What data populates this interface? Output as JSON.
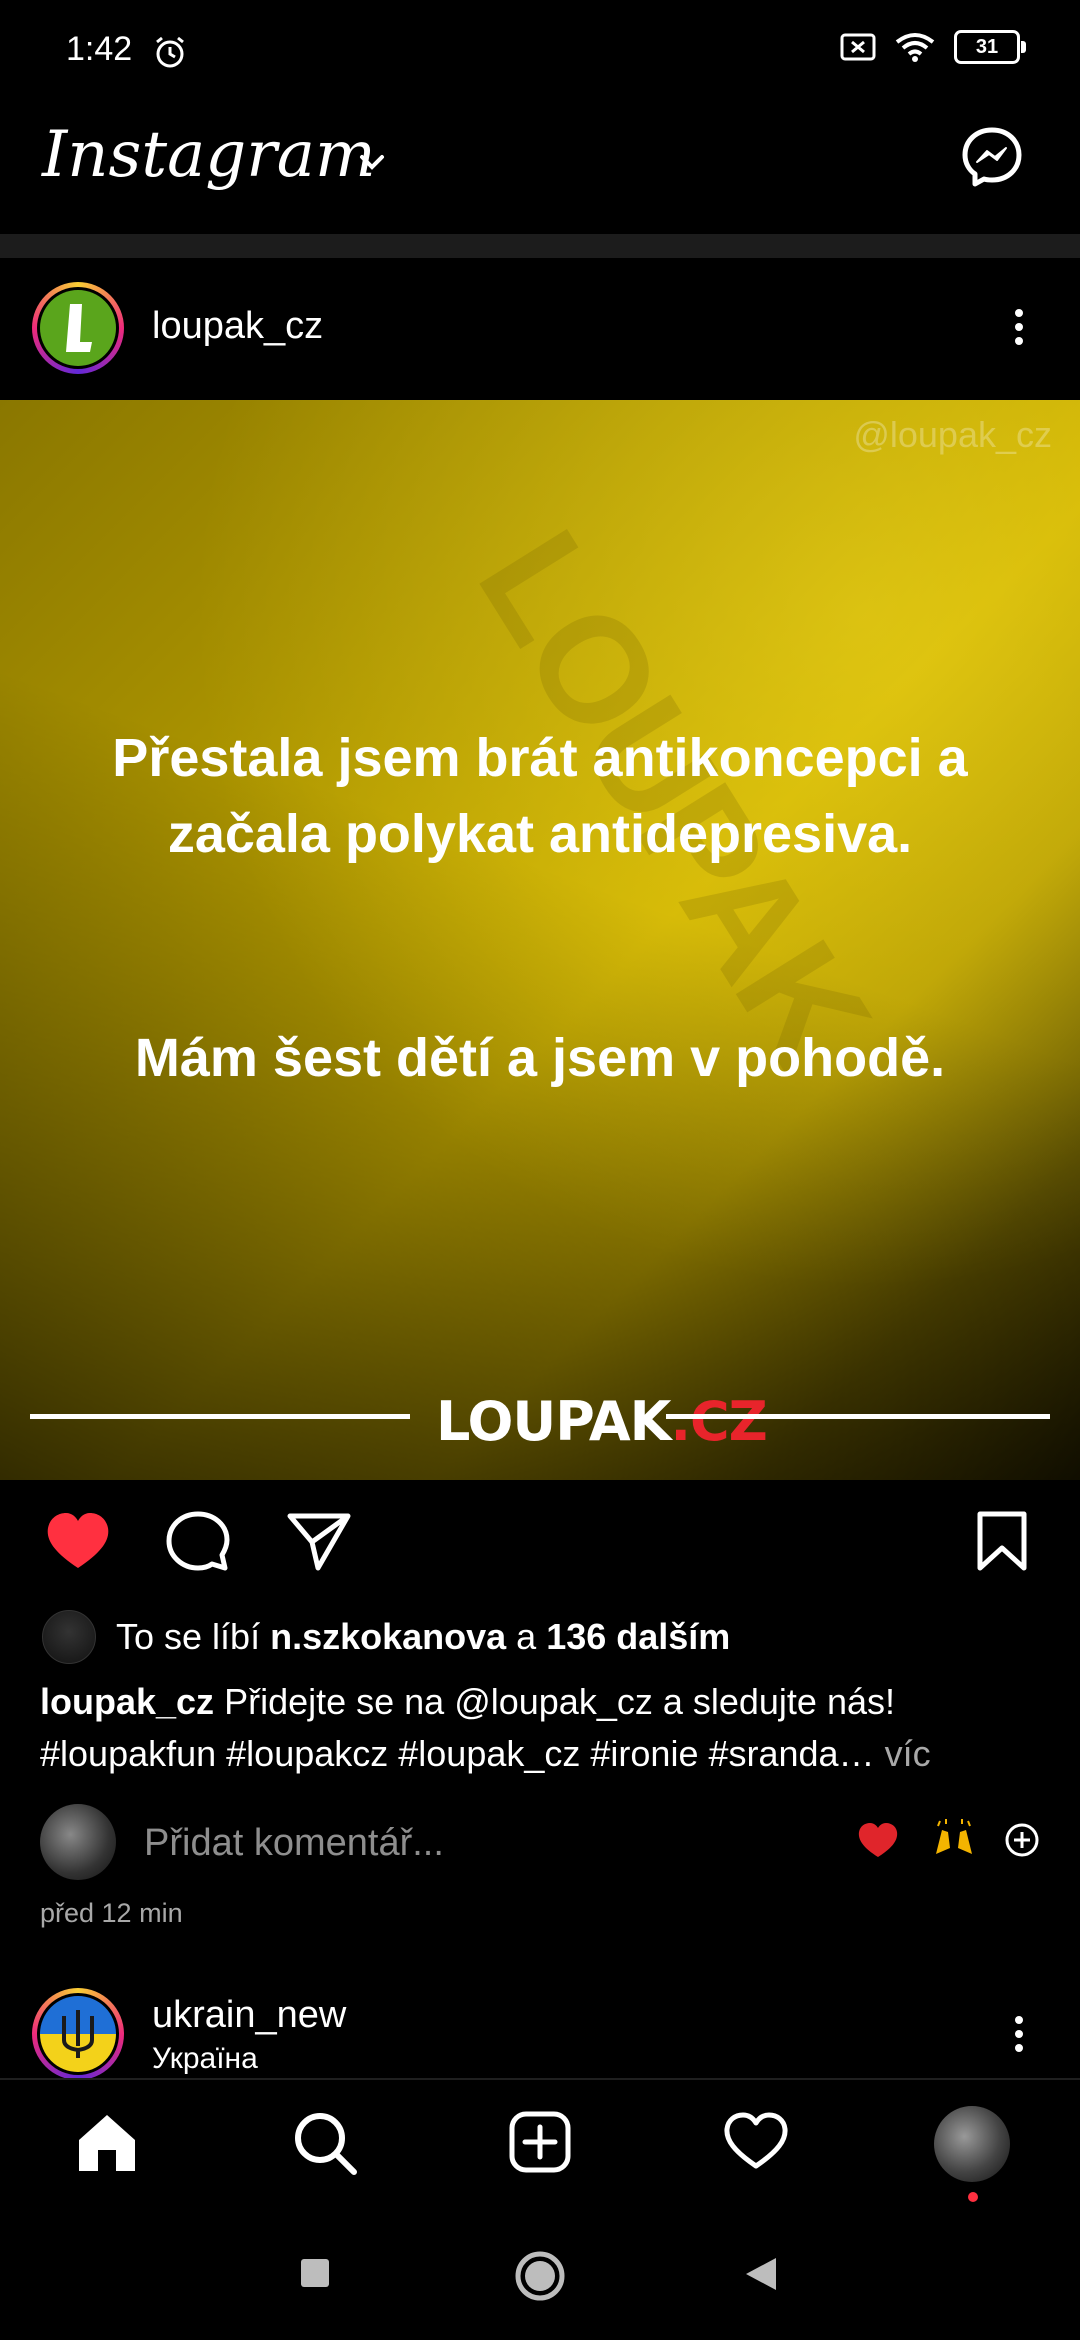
{
  "status_bar": {
    "time": "1:42",
    "battery": "31"
  },
  "header": {
    "logo": "Instagram"
  },
  "post": {
    "username": "loupak_cz",
    "watermark": "@loupak_cz",
    "image_text_line1": "Přestala jsem brát antikoncepci a",
    "image_text_line2": "začala polykat antidepresiva.",
    "image_text_line3": "Mám šest dětí a jsem v pohodě.",
    "brand_main": "LOUPAK",
    "brand_suffix": ".CZ",
    "likes_prefix": "To se líbí ",
    "likes_user": "n.szkokanova",
    "likes_mid": " a ",
    "likes_count": "136 dalším",
    "caption_user": "loupak_cz",
    "caption_text": " Přidejte se na @loupak_cz a sledujte nás!",
    "caption_tags": "#loupakfun #loupakcz #loupak_cz #ironie #sranda…",
    "caption_more": " víc",
    "comment_placeholder": "Přidat komentář...",
    "time_ago": "před 12 min"
  },
  "next_post": {
    "username": "ukrain_new",
    "location": "Україна"
  },
  "colors": {
    "like_red": "#ff3040",
    "background": "#000000"
  }
}
